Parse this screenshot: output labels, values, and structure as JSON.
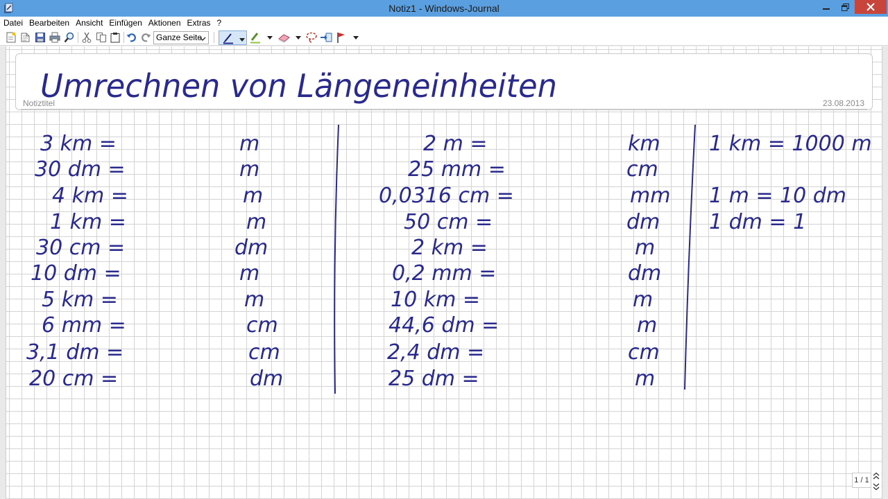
{
  "window": {
    "title": "Notiz1 - Windows-Journal"
  },
  "menu": [
    "Datei",
    "Bearbeiten",
    "Ansicht",
    "Einfügen",
    "Aktionen",
    "Extras",
    "?"
  ],
  "toolbar": {
    "zoom": "Ganze Seite",
    "icons": [
      "new-note-icon",
      "open-icon",
      "save-icon",
      "print-icon",
      "zoom-icon",
      "cut-icon",
      "copy-icon",
      "paste-icon",
      "undo-icon",
      "redo-icon",
      "pen-icon",
      "highlighter-icon",
      "eraser-icon",
      "lasso-icon",
      "insert-space-icon",
      "flag-icon"
    ]
  },
  "note": {
    "title": "Umrechnen von Längeneinheiten",
    "title_label": "Notiztitel",
    "date": "23.08.2013"
  },
  "exercises": {
    "column1": [
      {
        "from": "3 km =",
        "to": "m"
      },
      {
        "from": "30 dm =",
        "to": "m"
      },
      {
        "from": "4 km =",
        "to": "m"
      },
      {
        "from": "1 km =",
        "to": "m"
      },
      {
        "from": "30 cm =",
        "to": "dm"
      },
      {
        "from": "10 dm =",
        "to": "m"
      },
      {
        "from": "5 km =",
        "to": "m"
      },
      {
        "from": "6 mm =",
        "to": "cm"
      },
      {
        "from": "3,1 dm =",
        "to": "cm"
      },
      {
        "from": "20 cm =",
        "to": "dm"
      }
    ],
    "column2": [
      {
        "from": "2 m =",
        "to": "km"
      },
      {
        "from": "25 mm =",
        "to": "cm"
      },
      {
        "from": "0,0316 cm =",
        "to": "mm"
      },
      {
        "from": "50 cm =",
        "to": "dm"
      },
      {
        "from": "2 km =",
        "to": "m"
      },
      {
        "from": "0,2 mm =",
        "to": "dm"
      },
      {
        "from": "10 km =",
        "to": "m"
      },
      {
        "from": "44,6 dm =",
        "to": "m"
      },
      {
        "from": "2,4 dm =",
        "to": "cm"
      },
      {
        "from": "25 dm =",
        "to": "m"
      }
    ],
    "notes": [
      "1 km = 1000 m",
      "1 m = 10 dm",
      "1 dm = 1"
    ]
  },
  "pager": {
    "indicator": "1 / 1"
  },
  "colors": {
    "titlebar": "#5a9fe0",
    "ink": "#2a2a8c",
    "close": "#c7453b",
    "grid": "#d3d3d3"
  }
}
